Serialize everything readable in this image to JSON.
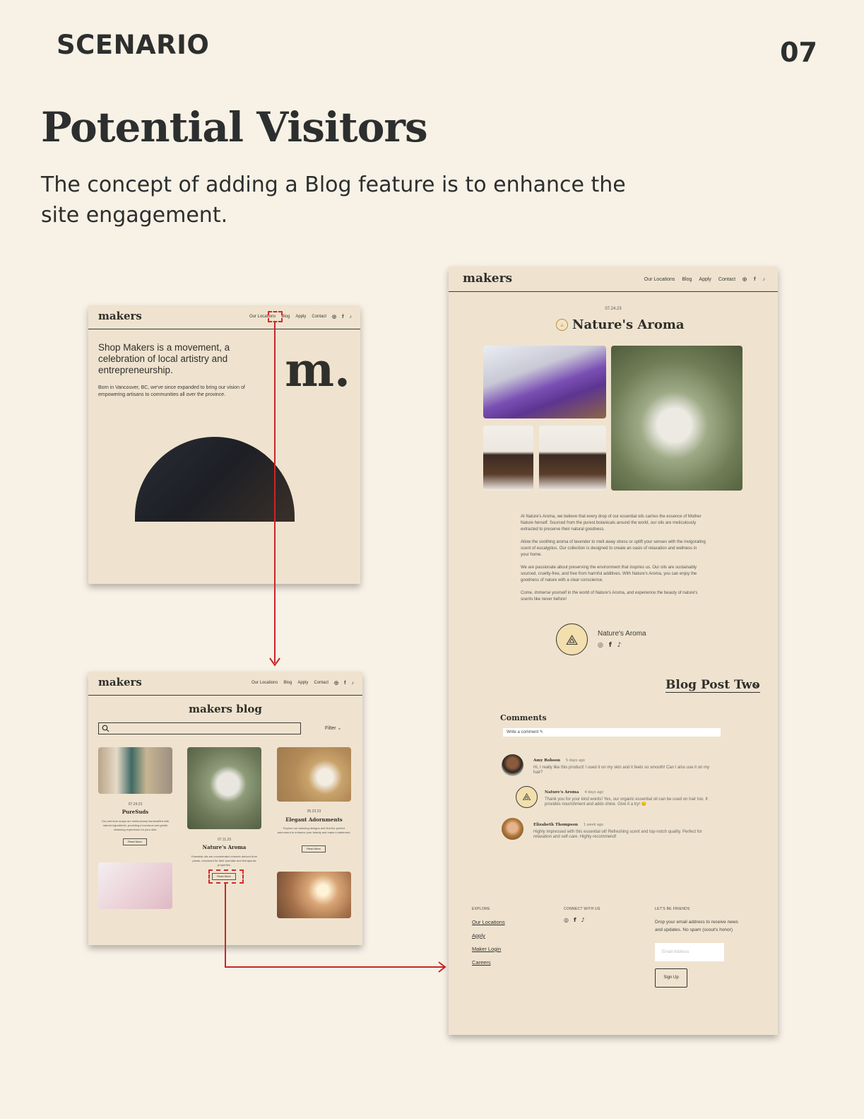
{
  "slide": {
    "label": "SCENARIO",
    "number": "07",
    "title": "Potential Visitors",
    "subtitle": "The concept of adding a Blog feature is to enhance the site engagement."
  },
  "colors": {
    "background": "#f8f1e6",
    "screen_bg": "#efe3cf",
    "text": "#2c2f2e",
    "annotation_red": "#d42b2b",
    "badge_gold": "#b88f4a"
  },
  "nav": {
    "logo": "makers",
    "links": [
      "Our Locations",
      "Blog",
      "Apply",
      "Contact"
    ],
    "social_icons": [
      "instagram-icon",
      "facebook-icon",
      "tiktok-icon"
    ],
    "social_glyphs": [
      "◎",
      "f",
      "♪"
    ]
  },
  "home": {
    "lead": "Shop Makers is a movement, a celebration of local artistry and entrepreneurship.",
    "body": "Born in Vancouver, BC, we've since expanded to bring our vision of empowering artisans to communities all over the province.",
    "monogram": "m."
  },
  "blog": {
    "title": "makers blog",
    "filter": "Filter",
    "cards": [
      {
        "date": "07.24.23",
        "title": "PureSuds",
        "desc": "Our premium soaps are meticulously handcrafted with natural ingredients, providing a luxurious and gentle cleansing experience for your skin.",
        "button": "Read More"
      },
      {
        "date": "07.11.23",
        "title": "Nature's Aroma",
        "desc": "Essential oils are concentrated extracts derived from plants, renowned for their aromatic and therapeutic properties.",
        "button": "Read More"
      },
      {
        "date": "05.23.23",
        "title": "Elegant Adornments",
        "desc": "Explore our stunning designs and find the perfect adornment to enhance your beauty and make a statement.",
        "button": "Read More"
      }
    ]
  },
  "post": {
    "date": "07.24.23",
    "title": "Nature's Aroma",
    "paragraphs": [
      "At Nature's Aroma, we believe that every drop of our essential oils carries the essence of Mother Nature herself. Sourced from the purest botanicals around the world, our oils are meticulously extracted to preserve their natural goodness.",
      "Allow the soothing aroma of lavender to melt away stress or uplift your senses with the invigorating scent of eucalyptus. Our collection is designed to create an oasis of relaxation and wellness in your home.",
      "We are passionate about preserving the environment that inspires us. Our oils are sustainably sourced, cruelty-free, and free from harmful additives. With Nature's Aroma, you can enjoy the goodness of nature with a clear conscience.",
      "Come, immerse yourself in the world of Nature's Aroma, and experience the beauty of nature's scents like never before!"
    ],
    "author": "Nature's Aroma",
    "next_label": "Blog Post Two",
    "comments_title": "Comments",
    "comment_placeholder": "Write a comment",
    "comments": [
      {
        "name": "Amy Robson",
        "time": "5 days ago",
        "text": "Hi, I really like this product! I used it on my skin and it feels so smooth! Can I also use it on my hair?"
      },
      {
        "name": "Nature's Aroma",
        "time": "4 days ago",
        "text": "Thank you for your kind words! Yes, our organic essential oil can be used on hair too. It provides nourishment and adds shine. Give it a try! 😊"
      },
      {
        "name": "Elizabeth Thompson",
        "time": "1 week ago",
        "text": "Highly impressed with this essential oil! Refreshing scent and top-notch quality. Perfect for relaxation and self-care. Highly recommend!"
      }
    ],
    "footer": {
      "explore_title": "EXPLORE",
      "explore_links": [
        "Our Locations",
        "Apply",
        "Maker Login",
        "Careers"
      ],
      "connect_title": "CONNECT WITH US",
      "friends_title": "LET'S BE FRIENDS",
      "friends_desc": "Drop your email address to receive news and updates. No spam (scout's honor)",
      "email_placeholder": "Email Address",
      "signup": "Sign Up"
    }
  }
}
